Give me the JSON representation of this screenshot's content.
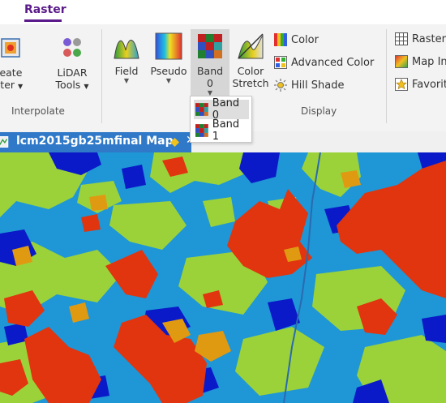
{
  "ribbon": {
    "active_tab": "Raster",
    "groups": {
      "interpolate": {
        "label": "Interpolate",
        "create_raster": {
          "line1": "reate",
          "line2": "ster"
        },
        "lidar_tools": {
          "line1": "LiDAR",
          "line2": "Tools"
        }
      },
      "display": {
        "label": "Display",
        "field": "Field",
        "pseudo": "Pseudo",
        "band": {
          "line1": "Band",
          "line2": "0"
        },
        "color_stretch": {
          "line1": "Color",
          "line2": "Stretch"
        },
        "color": "Color",
        "advanced_color": "Advanced Color",
        "hill_shade": "Hill Shade"
      },
      "right": {
        "raster": "Raster",
        "map_info": "Map In",
        "favorites": "Favorit"
      }
    }
  },
  "band_dropdown": {
    "options": [
      "Band 0",
      "Band 1"
    ],
    "selected": "Band 0"
  },
  "map_tab": {
    "title": "lcm2015gb25mfinal Map",
    "pin_icon": "diamond-pin-icon",
    "close_icon": "close-icon"
  },
  "colors": {
    "ribbon_tab": "#5a1a8a",
    "map_tab_bg": "#3079c8",
    "pin": "#f1c21b",
    "landcover_blue": "#1f96d6",
    "landcover_dark_blue": "#0a1ac8",
    "landcover_green": "#9bd23a",
    "landcover_red": "#e0350f",
    "landcover_orange": "#e09a12"
  }
}
